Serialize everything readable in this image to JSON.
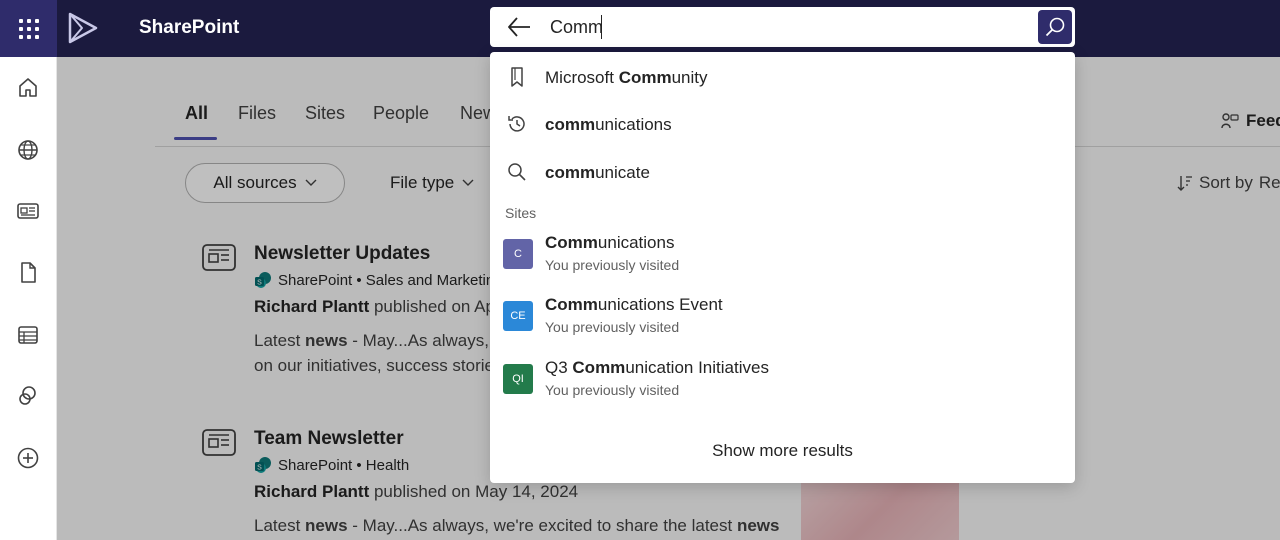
{
  "app": {
    "title": "SharePoint"
  },
  "search": {
    "value": "Comm",
    "suggestions": [
      {
        "icon": "bookmark-icon",
        "pre": "Microsoft ",
        "match": "Comm",
        "post": "unity"
      },
      {
        "icon": "history-icon",
        "pre": "",
        "match": "comm",
        "post": "unications"
      },
      {
        "icon": "search-icon",
        "pre": "",
        "match": "comm",
        "post": "unicate"
      }
    ],
    "sites_label": "Sites",
    "sites": [
      {
        "initials": "C",
        "color": "#6264a7",
        "pre": "",
        "match": "Comm",
        "post": "unications",
        "sub": "You previously visited"
      },
      {
        "initials": "CE",
        "color": "#2b88d8",
        "pre": "",
        "match": "Comm",
        "post": "unications Event",
        "sub": "You previously visited"
      },
      {
        "initials": "QI",
        "color": "#237b4b",
        "pre": "Q3 ",
        "match": "Comm",
        "post": "unication Initiatives",
        "sub": "You previously visited"
      }
    ],
    "show_more": "Show more results"
  },
  "tabs": [
    "All",
    "Files",
    "Sites",
    "People",
    "New"
  ],
  "feedback": "Feed",
  "filters": {
    "sources": "All sources",
    "file_type": "File type",
    "sort": "Sort by",
    "sort_value": "Re"
  },
  "results": [
    {
      "title": "Newsletter Updates",
      "source": "SharePoint • Sales and Marketin",
      "author": "Richard Plantt",
      "published": " published on Ap",
      "snippet_1_pre": "Latest ",
      "snippet_1_bold": "news",
      "snippet_1_post": " - May...As always, ",
      "snippet_2": "on our initiatives, success storie"
    },
    {
      "title": "Team Newsletter",
      "source": "SharePoint • Health",
      "author": "Richard Plantt",
      "published": " published on May 14, 2024",
      "snippet_1_pre": "Latest ",
      "snippet_1_bold": "news",
      "snippet_1_post": " - May...As always, we're excited to share the latest ",
      "snippet_1_bold2": "news"
    }
  ],
  "colors": {
    "topbar": "#1b1a3e",
    "waffle": "#2f2c6b",
    "accent": "#4f52b2"
  }
}
